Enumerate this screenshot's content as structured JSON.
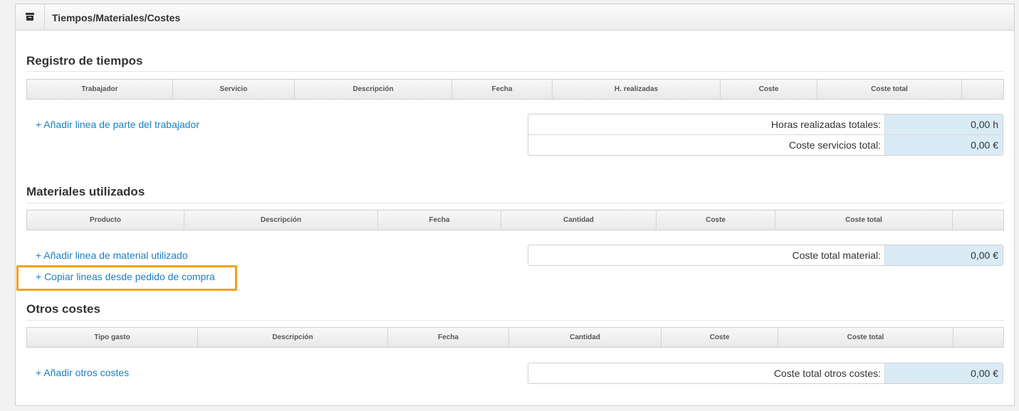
{
  "panel": {
    "title": "Tiempos/Materiales/Costes",
    "icon": "archive-box-icon"
  },
  "tiempos": {
    "title": "Registro de tiempos",
    "columns": [
      "Trabajador",
      "Servicio",
      "Descripción",
      "Fecha",
      "H. realizadas",
      "Coste",
      "Coste total",
      ""
    ],
    "add_link": "+ Añadir linea de parte del trabajador",
    "totals": [
      {
        "label": "Horas realizadas totales:",
        "value": "0,00 h"
      },
      {
        "label": "Coste servicios total:",
        "value": "0,00 €"
      }
    ]
  },
  "materiales": {
    "title": "Materiales utilizados",
    "columns": [
      "Producto",
      "Descripción",
      "Fecha",
      "Cantidad",
      "Coste",
      "Coste total",
      ""
    ],
    "add_link": "+ Añadir linea de material utilizado",
    "copy_link": "+ Copiar lineas desde pedido de compra",
    "totals": [
      {
        "label": "Coste total material:",
        "value": "0,00 €"
      }
    ]
  },
  "otros": {
    "title": "Otros costes",
    "columns": [
      "Tipo gasto",
      "Descripción",
      "Fecha",
      "Cantidad",
      "Coste",
      "Coste total",
      ""
    ],
    "add_link": "+ Añadir otros costes",
    "totals": [
      {
        "label": "Coste total otros costes:",
        "value": "0,00 €"
      }
    ]
  },
  "colors": {
    "link": "#1a7fc1",
    "highlight": "#f4a11d",
    "total_value_bg": "#d9ebf5"
  }
}
